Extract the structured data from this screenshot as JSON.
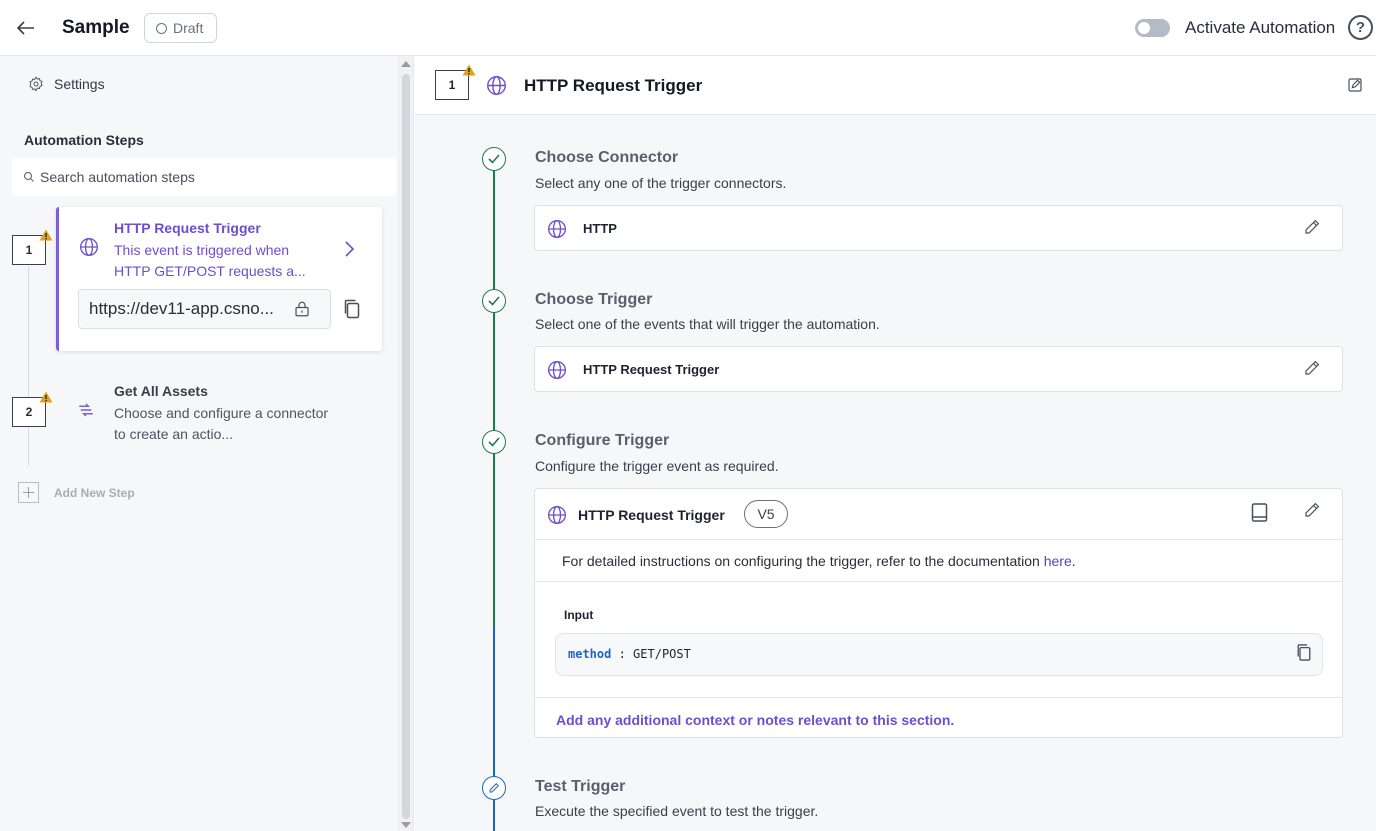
{
  "header": {
    "title": "Sample",
    "status": "Draft",
    "activate_label": "Activate Automation",
    "help_glyph": "?"
  },
  "sidebar": {
    "settings_label": "Settings",
    "steps_title": "Automation Steps",
    "search_placeholder": "Search automation steps",
    "steps": [
      {
        "number": "1",
        "title": "HTTP Request Trigger",
        "description": "This event is triggered when HTTP GET/POST requests a...",
        "url": "https://dev11-app.csno..."
      },
      {
        "number": "2",
        "title": "Get All Assets",
        "description": "Choose and configure a connector to create an actio..."
      }
    ],
    "add_step_label": "Add New Step"
  },
  "main": {
    "step_number": "1",
    "title": "HTTP Request Trigger",
    "sections": [
      {
        "title": "Choose Connector",
        "description": "Select any one of the trigger connectors.",
        "value": "HTTP"
      },
      {
        "title": "Choose Trigger",
        "description": "Select one of the events that will trigger the automation.",
        "value": "HTTP Request Trigger"
      },
      {
        "title": "Configure Trigger",
        "description": "Configure the trigger event as required.",
        "value": "HTTP Request Trigger",
        "version": "V5",
        "doc_text": "For detailed instructions on configuring the trigger, refer to the documentation ",
        "doc_link": "here",
        "doc_suffix": ".",
        "input_label": "Input",
        "input_key": "method",
        "input_sep": " : ",
        "input_value": "GET/POST",
        "notes_link": "Add any additional context or notes relevant to this section."
      },
      {
        "title": "Test Trigger",
        "description": "Execute the specified event to test the trigger."
      }
    ]
  },
  "colors": {
    "accent": "#6a4fcf",
    "success": "#1e7a4c",
    "active_step": "#1d63c8",
    "warning": "#e0a21a"
  },
  "icons": [
    "back-arrow-icon",
    "gear-icon",
    "search-icon",
    "globe-icon",
    "warning-icon",
    "chevron-right-icon",
    "lock-icon",
    "copy-icon",
    "shuffle-icon",
    "plus-icon",
    "edit-icon",
    "pencil-icon",
    "book-icon",
    "check-icon"
  ]
}
